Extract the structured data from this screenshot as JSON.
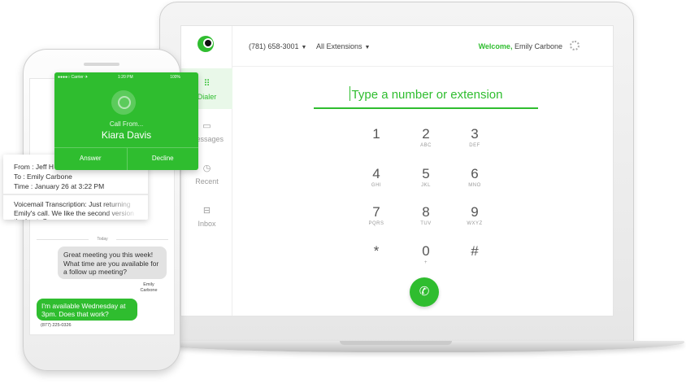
{
  "colors": {
    "accent": "#2fbd2f",
    "bubble_gray": "#e2e2e2"
  },
  "header": {
    "phone_number": "(781) 658-3001",
    "extensions": "All Extensions",
    "welcome": "Welcome,",
    "user_name": "Emily Carbone"
  },
  "sidebar": {
    "items": [
      {
        "label": "Dialer",
        "icon": "keypad-icon",
        "glyph": "⠿",
        "active": true
      },
      {
        "label": "Messages",
        "icon": "message-icon",
        "glyph": "▭",
        "active": false
      },
      {
        "label": "Recent",
        "icon": "clock-icon",
        "glyph": "◷",
        "active": false
      },
      {
        "label": "Inbox",
        "icon": "inbox-icon",
        "glyph": "⊟",
        "active": false
      }
    ]
  },
  "dialer": {
    "placeholder": "Type a number or extension",
    "keys": [
      {
        "num": "1",
        "letters": ""
      },
      {
        "num": "2",
        "letters": "ABC"
      },
      {
        "num": "3",
        "letters": "DEF"
      },
      {
        "num": "4",
        "letters": "GHI"
      },
      {
        "num": "5",
        "letters": "JKL"
      },
      {
        "num": "6",
        "letters": "MNO"
      },
      {
        "num": "7",
        "letters": "PQRS"
      },
      {
        "num": "8",
        "letters": "TUV"
      },
      {
        "num": "9",
        "letters": "WXYZ"
      },
      {
        "num": "*",
        "letters": ""
      },
      {
        "num": "0",
        "letters": "+"
      },
      {
        "num": "#",
        "letters": ""
      }
    ],
    "call_glyph": "✆"
  },
  "phone": {
    "status": {
      "carrier": "●●●●○ Carrier ✈",
      "time": "1:20 PM",
      "battery": "100%"
    },
    "incoming": {
      "caption": "Call From...",
      "caller": "Kiara Davis",
      "answer": "Answer",
      "decline": "Decline"
    },
    "voicemail": {
      "from": "From : Jeff H",
      "to": "To : Emily Carbone",
      "time": "Time : January 26 at 3:22 PM",
      "transcription": "Voicemail Transcription: Just returning Emily's call. We like the second version the best. Can"
    },
    "chat": {
      "divider": "Today",
      "incoming_text": "Great meeting you this week! What time are you available for a follow up meeting?",
      "incoming_sender": "Emily Carbone",
      "outgoing_text": "I'm available Wednesday at 3pm. Does that work?",
      "outgoing_sender": "(877) 225-0326"
    }
  }
}
